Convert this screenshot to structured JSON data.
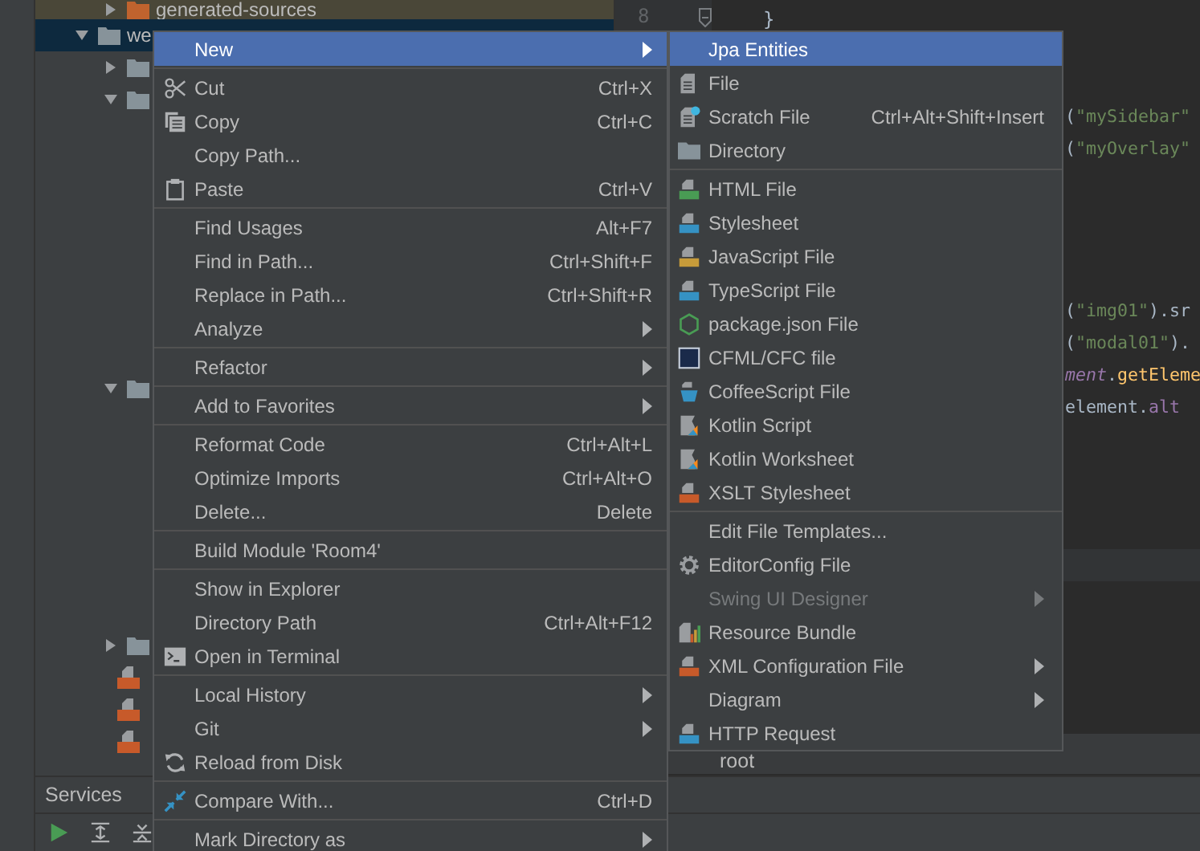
{
  "project_tree": {
    "items": [
      {
        "children": [
          {
            "label": "generated-sources",
            "kind": "generated-folder",
            "expanded": false,
            "selected": false
          }
        ]
      },
      {
        "label": "we",
        "kind": "folder",
        "expanded": true,
        "selected": true,
        "children": [
          {
            "kind": "folder",
            "expanded": false,
            "selected": false
          },
          {
            "kind": "folder",
            "expanded": true,
            "selected": false
          },
          {
            "kind": "folder",
            "expanded": true,
            "selected": false
          },
          {
            "kind": "folder",
            "expanded": false,
            "selected": false
          },
          {
            "kind": "jsp",
            "selected": false
          },
          {
            "kind": "jsp",
            "selected": false
          },
          {
            "kind": "jsp",
            "selected": false
          }
        ]
      }
    ]
  },
  "editor": {
    "line_numbers": [
      "8"
    ],
    "lines": [
      {
        "kind": "brace",
        "segments": [
          {
            "text": "}",
            "kind": "plain"
          }
        ]
      },
      {
        "kind": "fragment",
        "segments": [
          {
            "text": "(",
            "kind": "plain"
          },
          {
            "text": "\"mySidebar\"",
            "kind": "string"
          }
        ]
      },
      {
        "kind": "fragment",
        "segments": [
          {
            "text": "(",
            "kind": "plain"
          },
          {
            "text": "\"myOverlay\"",
            "kind": "string"
          }
        ]
      },
      {
        "kind": "fragment",
        "segments": [
          {
            "text": "(",
            "kind": "plain"
          },
          {
            "text": "\"img01\"",
            "kind": "string"
          },
          {
            "text": ").sr",
            "kind": "plain"
          }
        ]
      },
      {
        "kind": "fragment",
        "segments": [
          {
            "text": "(",
            "kind": "plain"
          },
          {
            "text": "\"modal01\"",
            "kind": "string"
          },
          {
            "text": ").",
            "kind": "plain"
          }
        ]
      },
      {
        "kind": "fragment",
        "segments": [
          {
            "text": "ment",
            "kind": "italic-field"
          },
          {
            "text": ".",
            "kind": "plain"
          },
          {
            "text": "getEleme",
            "kind": "method"
          }
        ]
      },
      {
        "kind": "fragment",
        "segments": [
          {
            "text": "element.",
            "kind": "plain"
          },
          {
            "text": "alt",
            "kind": "field"
          }
        ]
      }
    ],
    "lower_row": "root"
  },
  "services_panel": {
    "title": "Services"
  },
  "context_menu": {
    "groups": [
      {
        "items": [
          {
            "label": "New",
            "has_submenu": true,
            "selected": true,
            "disabled": false
          }
        ]
      },
      {
        "items": [
          {
            "label": "Cut",
            "shortcut": "Ctrl+X",
            "kind": "cut",
            "has_submenu": false,
            "selected": false,
            "disabled": false
          },
          {
            "label": "Copy",
            "shortcut": "Ctrl+C",
            "kind": "copy",
            "has_submenu": false,
            "selected": false,
            "disabled": false
          },
          {
            "label": "Copy Path...",
            "has_submenu": false,
            "selected": false,
            "disabled": false
          },
          {
            "label": "Paste",
            "shortcut": "Ctrl+V",
            "kind": "paste",
            "has_submenu": false,
            "selected": false,
            "disabled": false
          }
        ]
      },
      {
        "items": [
          {
            "label": "Find Usages",
            "shortcut": "Alt+F7",
            "has_submenu": false,
            "selected": false,
            "disabled": false
          },
          {
            "label": "Find in Path...",
            "shortcut": "Ctrl+Shift+F",
            "has_submenu": false,
            "selected": false,
            "disabled": false
          },
          {
            "label": "Replace in Path...",
            "shortcut": "Ctrl+Shift+R",
            "has_submenu": false,
            "selected": false,
            "disabled": false
          },
          {
            "label": "Analyze",
            "has_submenu": true,
            "selected": false,
            "disabled": false
          }
        ]
      },
      {
        "items": [
          {
            "label": "Refactor",
            "has_submenu": true,
            "selected": false,
            "disabled": false
          }
        ]
      },
      {
        "items": [
          {
            "label": "Add to Favorites",
            "has_submenu": true,
            "selected": false,
            "disabled": false
          }
        ]
      },
      {
        "items": [
          {
            "label": "Reformat Code",
            "shortcut": "Ctrl+Alt+L",
            "has_submenu": false,
            "selected": false,
            "disabled": false
          },
          {
            "label": "Optimize Imports",
            "shortcut": "Ctrl+Alt+O",
            "has_submenu": false,
            "selected": false,
            "disabled": false
          },
          {
            "label": "Delete...",
            "shortcut": "Delete",
            "has_submenu": false,
            "selected": false,
            "disabled": false
          }
        ]
      },
      {
        "items": [
          {
            "label": "Build Module 'Room4'",
            "has_submenu": false,
            "selected": false,
            "disabled": false
          }
        ]
      },
      {
        "items": [
          {
            "label": "Show in Explorer",
            "has_submenu": false,
            "selected": false,
            "disabled": false
          },
          {
            "label": "Directory Path",
            "shortcut": "Ctrl+Alt+F12",
            "has_submenu": false,
            "selected": false,
            "disabled": false
          },
          {
            "label": "Open in Terminal",
            "kind": "terminal",
            "has_submenu": false,
            "selected": false,
            "disabled": false
          }
        ]
      },
      {
        "items": [
          {
            "label": "Local History",
            "has_submenu": true,
            "selected": false,
            "disabled": false
          },
          {
            "label": "Git",
            "has_submenu": true,
            "selected": false,
            "disabled": false
          },
          {
            "label": "Reload from Disk",
            "kind": "reload",
            "has_submenu": false,
            "selected": false,
            "disabled": false
          }
        ]
      },
      {
        "items": [
          {
            "label": "Compare With...",
            "shortcut": "Ctrl+D",
            "kind": "compare",
            "has_submenu": false,
            "selected": false,
            "disabled": false
          }
        ]
      },
      {
        "items": [
          {
            "label": "Mark Directory as",
            "has_submenu": true,
            "selected": false,
            "disabled": false
          }
        ]
      }
    ]
  },
  "submenu": {
    "groups": [
      {
        "items": [
          {
            "label": "Jpa Entities",
            "has_submenu": false,
            "selected": true,
            "disabled": false
          },
          {
            "label": "File",
            "kind": "file",
            "has_submenu": false,
            "selected": false,
            "disabled": false
          },
          {
            "label": "Scratch File",
            "shortcut": "Ctrl+Alt+Shift+Insert",
            "kind": "scratch",
            "has_submenu": false,
            "selected": false,
            "disabled": false
          },
          {
            "label": "Directory",
            "kind": "directory",
            "has_submenu": false,
            "selected": false,
            "disabled": false
          }
        ]
      },
      {
        "items": [
          {
            "label": "HTML File",
            "kind": "html",
            "has_submenu": false,
            "selected": false,
            "disabled": false
          },
          {
            "label": "Stylesheet",
            "kind": "css",
            "has_submenu": false,
            "selected": false,
            "disabled": false
          },
          {
            "label": "JavaScript File",
            "kind": "js",
            "has_submenu": false,
            "selected": false,
            "disabled": false
          },
          {
            "label": "TypeScript File",
            "kind": "ts",
            "has_submenu": false,
            "selected": false,
            "disabled": false
          },
          {
            "label": "package.json File",
            "kind": "npm",
            "has_submenu": false,
            "selected": false,
            "disabled": false
          },
          {
            "label": "CFML/CFC file",
            "kind": "cfml",
            "has_submenu": false,
            "selected": false,
            "disabled": false
          },
          {
            "label": "CoffeeScript File",
            "kind": "coffee",
            "has_submenu": false,
            "selected": false,
            "disabled": false
          },
          {
            "label": "Kotlin Script",
            "kind": "kotlin",
            "has_submenu": false,
            "selected": false,
            "disabled": false
          },
          {
            "label": "Kotlin Worksheet",
            "kind": "kotlin",
            "has_submenu": false,
            "selected": false,
            "disabled": false
          },
          {
            "label": "XSLT Stylesheet",
            "kind": "xslt",
            "has_submenu": false,
            "selected": false,
            "disabled": false
          }
        ]
      },
      {
        "items": [
          {
            "label": "Edit File Templates...",
            "has_submenu": false,
            "selected": false,
            "disabled": false
          },
          {
            "label": "EditorConfig File",
            "kind": "gear",
            "has_submenu": false,
            "selected": false,
            "disabled": false
          },
          {
            "label": "Swing UI Designer",
            "has_submenu": true,
            "selected": false,
            "disabled": true
          },
          {
            "label": "Resource Bundle",
            "kind": "bundle",
            "has_submenu": false,
            "selected": false,
            "disabled": false
          },
          {
            "label": "XML Configuration File",
            "kind": "xml",
            "has_submenu": true,
            "selected": false,
            "disabled": false
          },
          {
            "label": "Diagram",
            "has_submenu": true,
            "selected": false,
            "disabled": false
          },
          {
            "label": "HTTP Request",
            "kind": "api",
            "has_submenu": false,
            "selected": false,
            "disabled": false
          }
        ]
      }
    ]
  }
}
